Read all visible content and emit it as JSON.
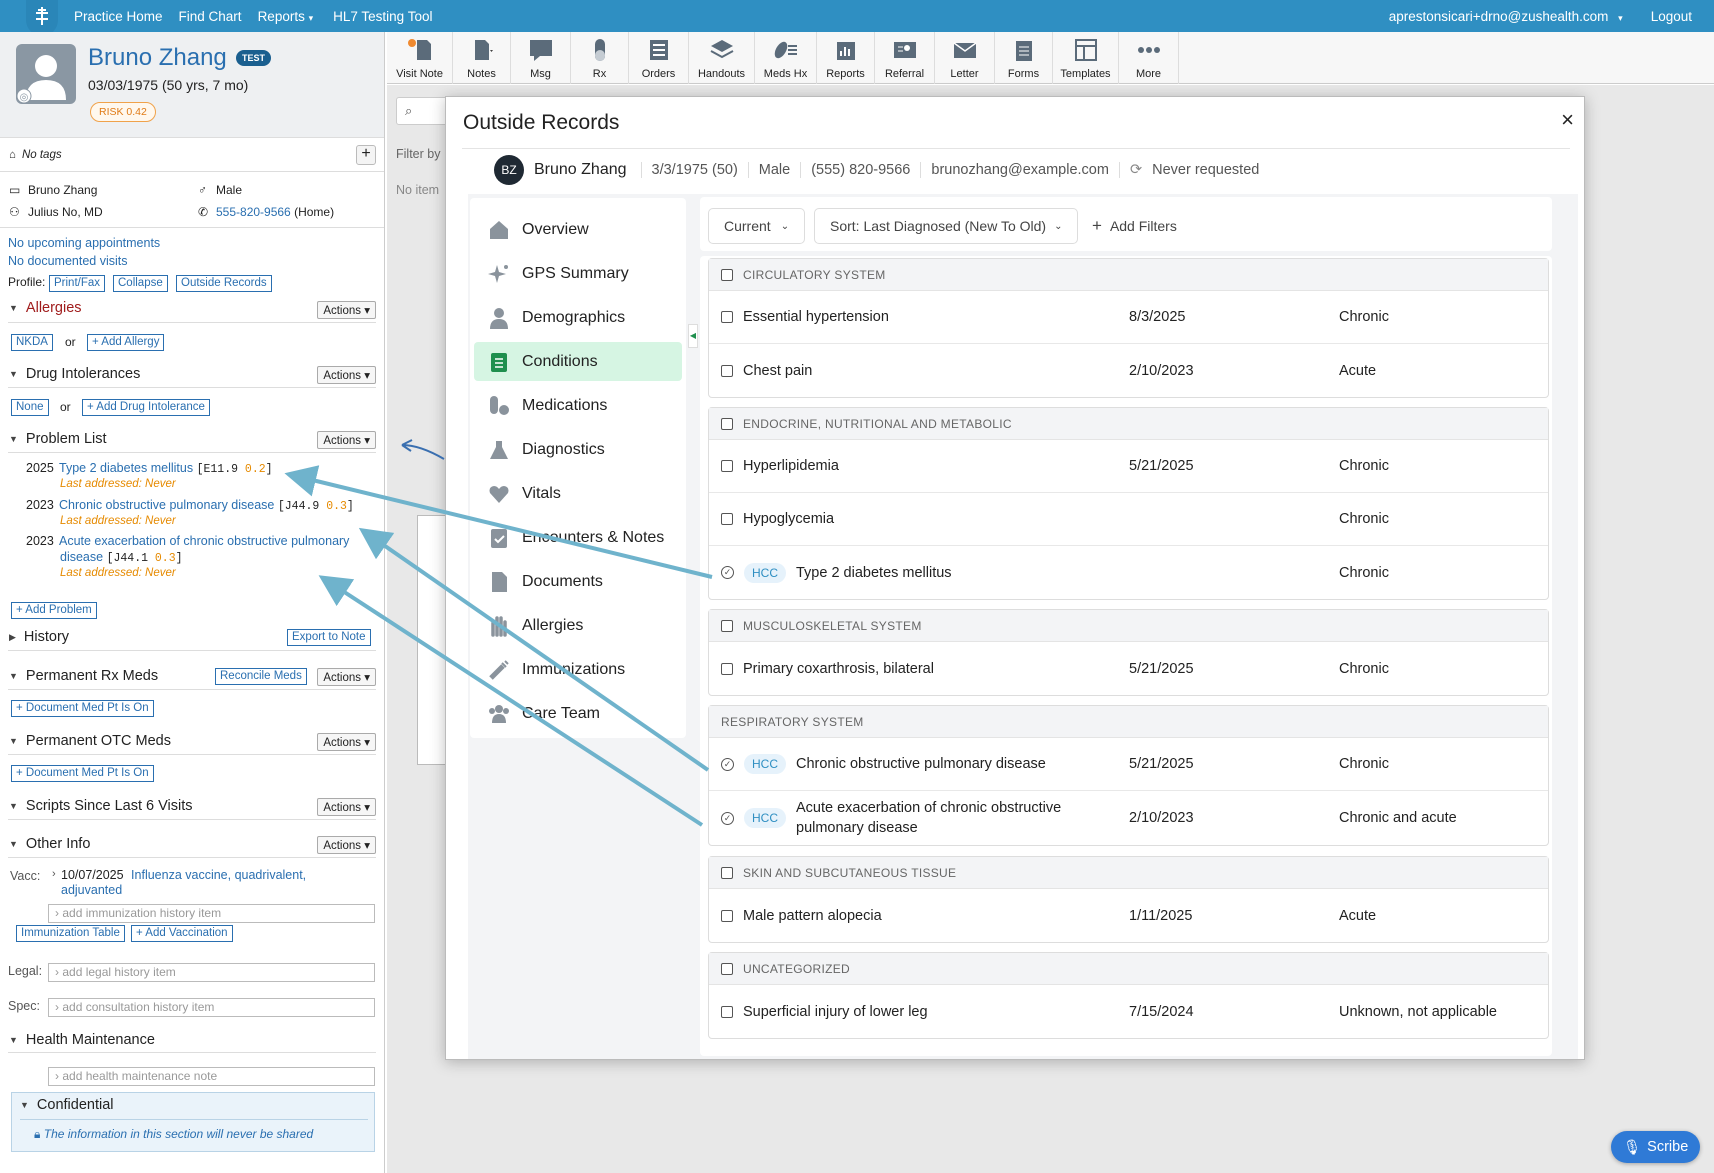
{
  "topnav": {
    "links": [
      "Practice Home",
      "Find Chart",
      "Reports",
      "HL7 Testing Tool"
    ],
    "user_email": "aprestonsicari+drno@zushealth.com",
    "logout": "Logout"
  },
  "patient": {
    "name": "Bruno Zhang",
    "test_badge": "TEST",
    "dob": "03/03/1975 (50 yrs, 7 mo)",
    "risk": "RISK 0.42",
    "tags": "No tags",
    "info_name": "Bruno Zhang",
    "gender": "Male",
    "provider": "Julius No, MD",
    "phone": "555-820-9566",
    "phone_type": "(Home)"
  },
  "left": {
    "no_appts": "No upcoming appointments",
    "no_visits": "No documented visits",
    "profile_label": "Profile:",
    "profile_buttons": [
      "Print/Fax",
      "Collapse",
      "Outside Records"
    ],
    "actions_label": "Actions",
    "allergies": {
      "title": "Allergies",
      "nkda": "NKDA",
      "or": "or",
      "add": "+ Add Allergy"
    },
    "intolerances": {
      "title": "Drug Intolerances",
      "none": "None",
      "or": "or",
      "add": "+ Add Drug Intolerance"
    },
    "problem_list": {
      "title": "Problem List",
      "items": [
        {
          "year": "2025",
          "name": "Type 2 diabetes mellitus",
          "code": "E11.9",
          "score": "0.2",
          "last": "Last addressed: Never"
        },
        {
          "year": "2023",
          "name": "Chronic obstructive pulmonary disease",
          "code": "J44.9",
          "score": "0.3",
          "last": "Last addressed: Never"
        },
        {
          "year": "2023",
          "name": "Acute exacerbation of chronic obstructive pulmonary",
          "name2": "disease",
          "code": "J44.1",
          "score": "0.3",
          "last": "Last addressed: Never"
        }
      ],
      "add": "+ Add Problem"
    },
    "history": {
      "title": "History",
      "export": "Export to Note"
    },
    "rx_meds": {
      "title": "Permanent Rx Meds",
      "reconcile": "Reconcile Meds",
      "add": "+ Document Med Pt Is On"
    },
    "otc_meds": {
      "title": "Permanent OTC Meds",
      "add": "+ Document Med Pt Is On"
    },
    "scripts": {
      "title": "Scripts Since Last 6 Visits"
    },
    "other_info": {
      "title": "Other Info",
      "vacc_label": "Vacc:",
      "vacc_date": "10/07/2025",
      "vacc_name": "Influenza vaccine, quadrivalent,",
      "vacc_name2": "adjuvanted",
      "imm_placeholder": "add immunization history item",
      "imm_table": "Immunization Table",
      "add_vacc": "+ Add Vaccination",
      "legal_label": "Legal:",
      "legal_placeholder": "add legal history item",
      "spec_label": "Spec:",
      "spec_placeholder": "add consultation history item"
    },
    "health_maint": {
      "title": "Health Maintenance",
      "placeholder": "add health maintenance note"
    },
    "confidential": {
      "title": "Confidential",
      "note": "The information in this section will never be shared"
    }
  },
  "toolbar": [
    "Visit Note",
    "Notes",
    "Msg",
    "Rx",
    "Orders",
    "Handouts",
    "Meds Hx",
    "Reports",
    "Referral",
    "Letter",
    "Forms",
    "Templates",
    "More"
  ],
  "background": {
    "filter_by": "Filter by",
    "no_items": "No item"
  },
  "modal": {
    "title": "Outside Records",
    "close": "×",
    "initials": "BZ",
    "patient_name": "Bruno Zhang",
    "dob": "3/3/1975 (50)",
    "sex": "Male",
    "phone": "(555) 820-9566",
    "email": "brunozhang@example.com",
    "requested": "Never requested",
    "nav": [
      "Overview",
      "GPS Summary",
      "Demographics",
      "Conditions",
      "Medications",
      "Diagnostics",
      "Vitals",
      "Encounters & Notes",
      "Documents",
      "Allergies",
      "Immunizations",
      "Care Team"
    ],
    "active_nav": "Conditions",
    "filter_current": "Current",
    "sort": "Sort: Last Diagnosed (New To Old)",
    "add_filters": "Add Filters",
    "hcc": "HCC",
    "groups": [
      {
        "title": "CIRCULATORY SYSTEM",
        "checkbox": true,
        "rows": [
          {
            "name": "Essential hypertension",
            "date": "8/3/2025",
            "status": "Chronic",
            "hcc": false
          },
          {
            "name": "Chest pain",
            "date": "2/10/2023",
            "status": "Acute",
            "hcc": false
          }
        ]
      },
      {
        "title": "ENDOCRINE, NUTRITIONAL AND METABOLIC",
        "checkbox": true,
        "rows": [
          {
            "name": "Hyperlipidemia",
            "date": "5/21/2025",
            "status": "Chronic",
            "hcc": false
          },
          {
            "name": "Hypoglycemia",
            "date": "",
            "status": "Chronic",
            "hcc": false
          },
          {
            "name": "Type 2 diabetes mellitus",
            "date": "",
            "status": "Chronic",
            "hcc": true
          }
        ]
      },
      {
        "title": "MUSCULOSKELETAL SYSTEM",
        "checkbox": true,
        "rows": [
          {
            "name": "Primary coxarthrosis, bilateral",
            "date": "5/21/2025",
            "status": "Chronic",
            "hcc": false
          }
        ]
      },
      {
        "title": "RESPIRATORY SYSTEM",
        "checkbox": false,
        "rows": [
          {
            "name": "Chronic obstructive pulmonary disease",
            "date": "5/21/2025",
            "status": "Chronic",
            "hcc": true
          },
          {
            "name": "Acute exacerbation of chronic obstructive",
            "name2": "pulmonary disease",
            "date": "2/10/2023",
            "status": "Chronic and acute",
            "hcc": true
          }
        ]
      },
      {
        "title": "SKIN AND SUBCUTANEOUS TISSUE",
        "checkbox": true,
        "rows": [
          {
            "name": "Male pattern alopecia",
            "date": "1/11/2025",
            "status": "Acute",
            "hcc": false
          }
        ]
      },
      {
        "title": "UNCATEGORIZED",
        "checkbox": true,
        "rows": [
          {
            "name": "Superficial injury of lower leg",
            "date": "7/15/2024",
            "status": "Unknown, not applicable",
            "hcc": false
          }
        ]
      }
    ]
  },
  "scribe": "Scribe",
  "colors": {
    "brand": "#2f8fc2",
    "link": "#2a6fb0",
    "active_nav": "#d6f5e3",
    "arrow": "#6fb3cc"
  }
}
